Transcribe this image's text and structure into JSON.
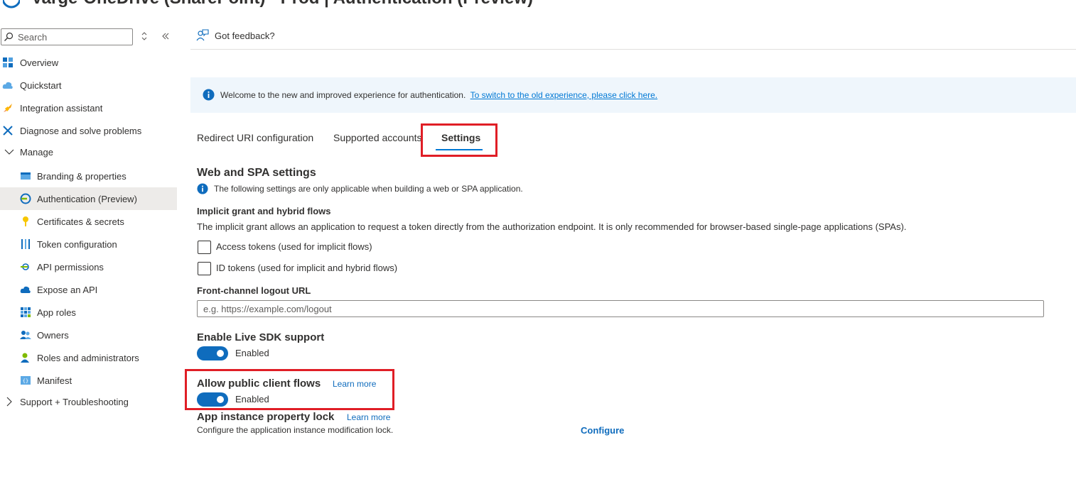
{
  "header": {
    "title": "Varge-OneDrive (SharePoint) - Prod | Authentication (Preview)"
  },
  "sidebar": {
    "search_placeholder": "Search",
    "items": [
      {
        "label": "Overview",
        "icon": "overview-grid-icon"
      },
      {
        "label": "Quickstart",
        "icon": "quickstart-cloud-icon"
      },
      {
        "label": "Integration assistant",
        "icon": "rocket-icon"
      },
      {
        "label": "Diagnose and solve problems",
        "icon": "wrench-icon"
      },
      {
        "label": "Manage",
        "icon": "chevron-down-icon"
      },
      {
        "label": "Branding & properties",
        "icon": "branding-icon"
      },
      {
        "label": "Authentication (Preview)",
        "icon": "authentication-icon"
      },
      {
        "label": "Certificates & secrets",
        "icon": "key-icon"
      },
      {
        "label": "Token configuration",
        "icon": "token-bars-icon"
      },
      {
        "label": "API permissions",
        "icon": "api-permissions-icon"
      },
      {
        "label": "Expose an API",
        "icon": "cloud-api-icon"
      },
      {
        "label": "App roles",
        "icon": "app-roles-grid-icon"
      },
      {
        "label": "Owners",
        "icon": "owners-people-icon"
      },
      {
        "label": "Roles and administrators",
        "icon": "roles-person-icon"
      },
      {
        "label": "Manifest",
        "icon": "manifest-icon"
      },
      {
        "label": "Support + Troubleshooting",
        "icon": "chevron-right-icon"
      }
    ]
  },
  "toolbar": {
    "feedback_label": "Got feedback?"
  },
  "banner": {
    "text": "Welcome to the new and improved experience for authentication.",
    "link": "To switch to the old experience, please click here."
  },
  "tabs": [
    {
      "label": "Redirect URI configuration"
    },
    {
      "label": "Supported accounts"
    },
    {
      "label": "Settings"
    }
  ],
  "web_spa": {
    "heading": "Web and SPA settings",
    "info": "The following settings are only applicable when building a web or SPA application.",
    "implicit_heading": "Implicit grant and hybrid flows",
    "implicit_desc": "The implicit grant allows an application to request a token directly from the authorization endpoint.  It is only recommended for browser-based single-page applications (SPAs).",
    "access_tokens_label": "Access tokens (used for implicit flows)",
    "id_tokens_label": "ID tokens (used for implicit and hybrid flows)",
    "logout_label": "Front-channel logout URL",
    "logout_placeholder": "e.g. https://example.com/logout"
  },
  "live_sdk": {
    "heading": "Enable Live SDK support",
    "state": "Enabled",
    "enabled": true
  },
  "public_client": {
    "heading": "Allow public client flows",
    "learn_more": "Learn more",
    "state": "Enabled",
    "enabled": true
  },
  "instance_lock": {
    "heading": "App instance property lock",
    "learn_more": "Learn more",
    "desc": "Configure the application instance modification lock.",
    "configure": "Configure"
  },
  "colors": {
    "accent": "#0f6cbd",
    "highlight": "#e01e26",
    "banner_bg": "#eff6fc",
    "selected_bg": "#edebe9"
  }
}
